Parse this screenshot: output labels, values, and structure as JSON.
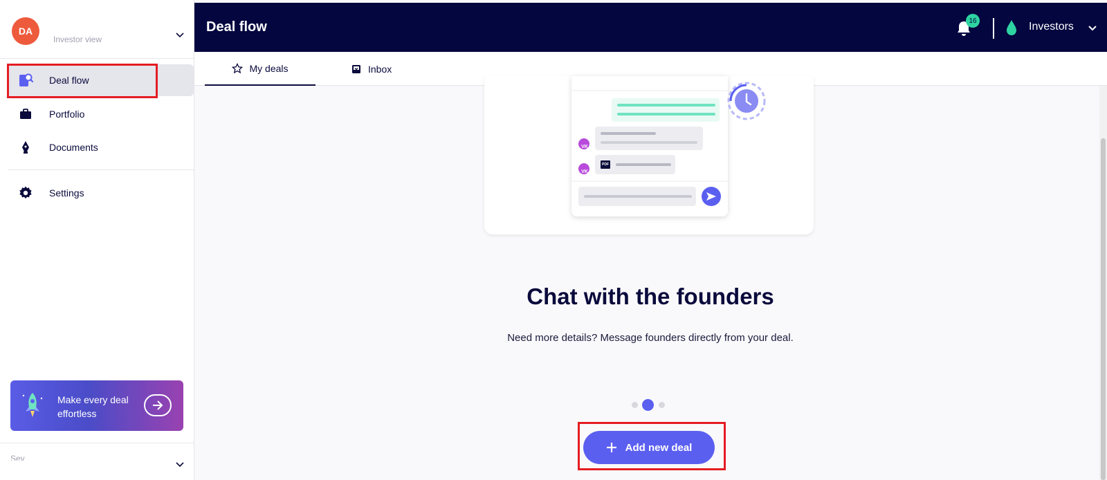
{
  "user": {
    "initials": "DA",
    "view_label": "Investor view"
  },
  "sidebar": {
    "items": [
      {
        "label": "Deal flow",
        "icon": "deal-flow-icon",
        "active": true
      },
      {
        "label": "Portfolio",
        "icon": "briefcase-icon"
      },
      {
        "label": "Documents",
        "icon": "pen-nib-icon"
      },
      {
        "label": "Settings",
        "icon": "gear-icon"
      }
    ],
    "promo": {
      "text": "Make every deal effortless",
      "icon": "rocket-icon"
    },
    "bottom_text": "Sev"
  },
  "header": {
    "title": "Deal flow",
    "notification_count": "16",
    "workspace": "Investors"
  },
  "tabs": [
    {
      "label": "My deals",
      "icon": "star-icon",
      "active": true
    },
    {
      "label": "Inbox",
      "icon": "inbox-icon"
    }
  ],
  "illustration": {
    "avatar_initials": "VK",
    "file_tag": "PDF"
  },
  "main": {
    "headline": "Chat with the founders",
    "subline": "Need more details? Message founders directly from your deal.",
    "carousel": {
      "count": 3,
      "active": 2
    },
    "add_button": "Add new deal"
  },
  "colors": {
    "navy": "#03063f",
    "accent": "#5b5ff0",
    "badge": "#2ed3a2",
    "avatar": "#ee5a3c",
    "highlight": "#e51c23"
  }
}
